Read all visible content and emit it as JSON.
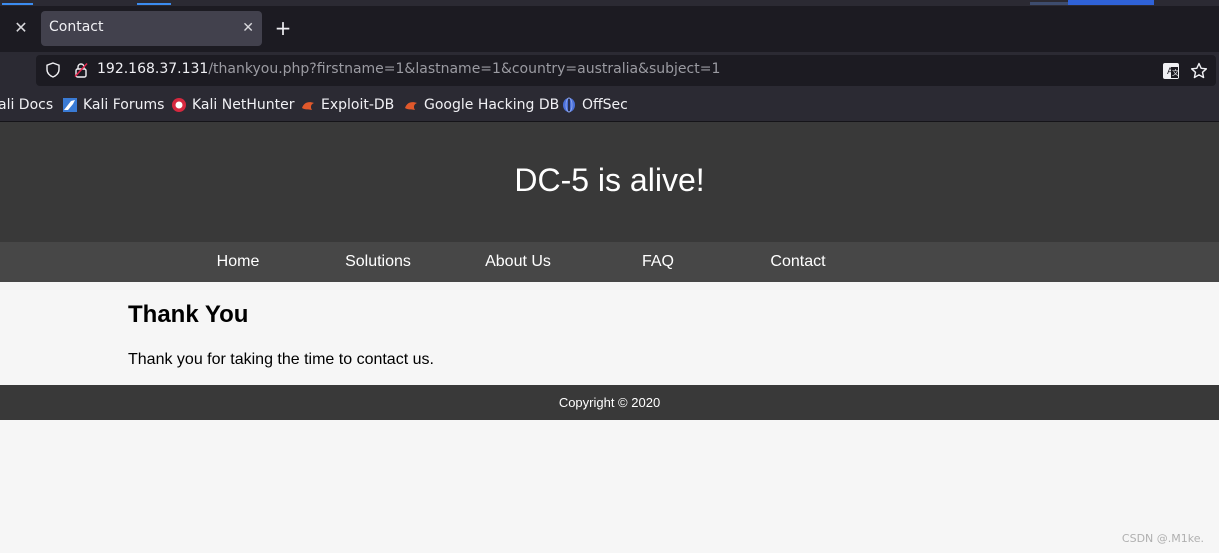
{
  "browser": {
    "tab": {
      "title": "Contact"
    },
    "url": {
      "host": "192.168.37.131",
      "path": "/thankyou.php?firstname=1&lastname=1&country=australia&subject=1"
    },
    "bookmarks": [
      {
        "label": "ali Docs",
        "icon": "none"
      },
      {
        "label": "Kali Forums",
        "icon": "kali-forums-icon"
      },
      {
        "label": "Kali NetHunter",
        "icon": "kali-nethunter-icon"
      },
      {
        "label": "Exploit-DB",
        "icon": "exploit-db-icon"
      },
      {
        "label": "Google Hacking DB",
        "icon": "ghdb-icon"
      },
      {
        "label": "OffSec",
        "icon": "offsec-icon"
      }
    ]
  },
  "site": {
    "title": "DC-5 is alive!",
    "nav": [
      "Home",
      "Solutions",
      "About Us",
      "FAQ",
      "Contact"
    ],
    "heading": "Thank You",
    "message": "Thank you for taking the time to contact us.",
    "footer": "Copyright © 2020"
  },
  "watermark": "CSDN @.M1ke.",
  "colors": {
    "header_bg": "#393939",
    "nav_bg": "#474747",
    "page_bg": "#f6f6f6",
    "chrome_bg": "#2b2a33",
    "tabbar_bg": "#1c1b22"
  }
}
